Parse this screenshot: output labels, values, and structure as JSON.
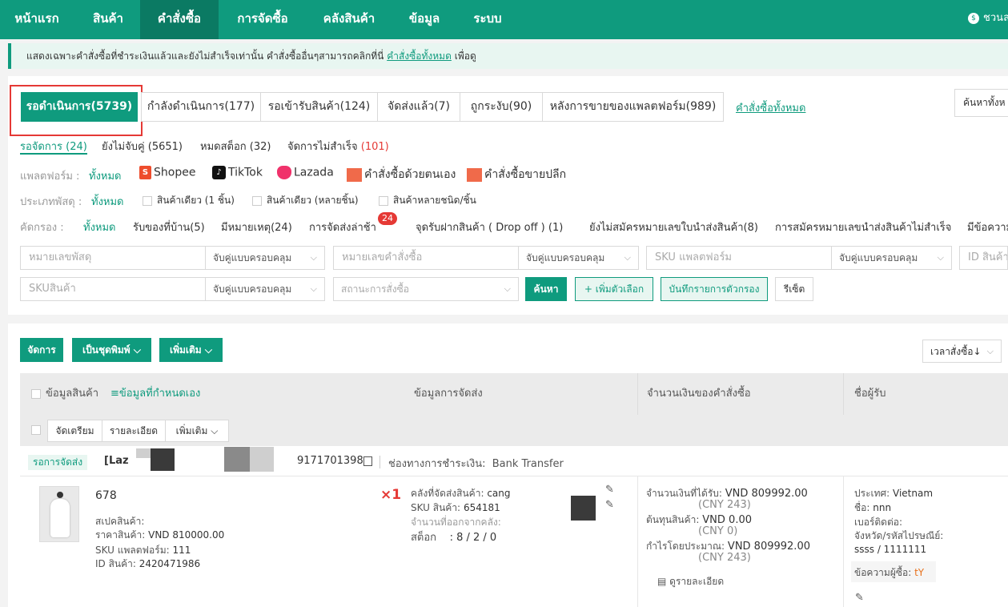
{
  "nav": {
    "items": [
      "หน้าแรก",
      "สินค้า",
      "คำสั่งซื้อ",
      "การจัดซื้อ",
      "คลังสินค้า",
      "ข้อมูล",
      "ระบบ"
    ],
    "user": "ชวนล"
  },
  "notice": {
    "text": "แสดงเฉพาะคำสั่งซื้อที่ชำระเงินแล้วและยังไม่สำเร็จเท่านั้น คำสั่งซื้ออื่นๆสามารถคลิกที่นี่",
    "link": "คำสั่งซื้อทั้งหมด",
    "tail": "เพื่อดู"
  },
  "tabs": [
    "รอดำเนินการ(5739)",
    "กำลังดำเนินการ(177)",
    "รอเข้ารับสินค้า(124)",
    "จัดส่งแล้ว(7)",
    "ถูกระงับ(90)",
    "หลังการขายของแพลตฟอร์ม(989)"
  ],
  "all_orders_link": "คำสั่งซื้อทั้งหมด",
  "search_all": "ค้นหาทั้งห",
  "subtabs": [
    {
      "label": "รอจัดการ (24)"
    },
    {
      "label": "ยังไม่จับคู่ (5651)"
    },
    {
      "label": "หมดสต็อก (32)"
    },
    {
      "label": "จัดการไม่สำเร็จ",
      "count": "(101)"
    }
  ],
  "platform": {
    "label": "แพลตฟอร์ม :",
    "all": "ทั้งหมด",
    "items": [
      "Shopee",
      "TikTok",
      "Lazada",
      "คำสั่งซื้อด้วยตนเอง",
      "คำสั่งซื้อขายปลีก"
    ]
  },
  "package": {
    "label": "ประเภทพัสดุ :",
    "all": "ทั้งหมด",
    "items": [
      "สินค้าเดียว (1 ชิ้น)",
      "สินค้าเดียว (หลายชิ้น)",
      "สินค้าหลายชนิด/ชิ้น"
    ]
  },
  "screen": {
    "label": "คัดกรอง :",
    "all": "ทั้งหมด",
    "items": [
      "รับของที่บ้าน(5)",
      "มีหมายเหตุ(24)",
      "การจัดส่งล่าช้า",
      "จุดรับฝากสินค้า ( Drop off ) (1)",
      "ยังไม่สมัครหมายเลขใบนำส่งสินค้า(8)",
      "การสมัครหมายเลขนำส่งสินค้าไม่สำเร็จ",
      "มีข้อความ"
    ],
    "late_badge": "24"
  },
  "search": {
    "tracking_ph": "หมายเลขพัสดุ",
    "order_ph": "หมายเลขคำสั่งซื้อ",
    "sku_platform_ph": "SKU แพลตฟอร์ม",
    "id_ph": "ID สินค้า",
    "sku_ph": "SKUสินค้า",
    "status_ph": "สถานะการสั่งซื้อ",
    "match_mode": "จับคู่แบบครอบคลุม",
    "btn_search": "ค้นหา",
    "btn_more_options": "+ เพิ่มตัวเลือก",
    "btn_save_filter": "บันทึกรายการตัวกรอง",
    "btn_reset": "รีเซ็ต"
  },
  "actions": {
    "manage": "จัดการ",
    "print_batch": "เป็นชุดพิมพ์",
    "more": "เพิ่มเติม",
    "sort": "เวลาสั่งซื้อ↓"
  },
  "table_headers": {
    "product": "ข้อมูลสินค้า",
    "custom": "ข้อมูลที่กำหนดเอง",
    "shipping": "ข้อมูลการจัดส่ง",
    "amount": "จำนวนเงินของคำสั่งซื้อ",
    "buyer": "ชื่อผู้รับ"
  },
  "row_actions": {
    "prepare": "จัดเตรียม",
    "detail": "รายละเอียด",
    "more": "เพิ่มเติม"
  },
  "order": {
    "status": "รอการจัดส่ง",
    "platform_tag": "[Laz",
    "order_no_tail": "9171701398",
    "payment_label": "ช่องทางการชำระเงิน:",
    "payment_value": "Bank Transfer",
    "product_name": "678",
    "spec_label": "สเปคสินค้า:",
    "price_label": "ราคาสินค้า:",
    "price_value": "VND 810000.00",
    "sku_platform_label": "SKU แพลตฟอร์ม:",
    "sku_platform_value": "111",
    "product_id_label": "ID สินค้า:",
    "product_id_value": "2420471986",
    "qty": "×1",
    "warehouse_label": "คลังที่จัดส่งสินค้า:",
    "warehouse_value": "cang",
    "sku_label": "SKU สินค้า:",
    "sku_value": "654181",
    "out_qty_label": "จำนวนที่ออกจากคลัง:",
    "stock_label": "สต็อก",
    "stock_value": ": 8 / 2 / 0",
    "received_label": "จำนวนเงินที่ได้รับ:",
    "received_value": "VND 809992.00",
    "received_cny": "(CNY 243)",
    "cost_label": "ต้นทุนสินค้า:",
    "cost_value": "VND 0.00",
    "cost_cny": "(CNY 0)",
    "profit_label": "กำไรโดยประมาณ:",
    "profit_value": "VND 809992.00",
    "profit_cny": "(CNY 243)",
    "detail_link": "ดูรายละเอียด",
    "country_label": "ประเทศ:",
    "country_value": "Vietnam",
    "name_label": "ชื่อ:",
    "name_value": "nnn",
    "phone_label": "เบอร์ติดต่อ:",
    "province_label": "จังหวัด/รหัสไปรษณีย์:",
    "province_value": "ssss / 1111111",
    "buyer_msg_label": "ข้อความผู้ซื้อ:",
    "buyer_msg_value": "tY"
  },
  "colors": {
    "brand": "#0f9b7e",
    "brand_dark": "#0b7a63",
    "highlight": "#e53935"
  }
}
